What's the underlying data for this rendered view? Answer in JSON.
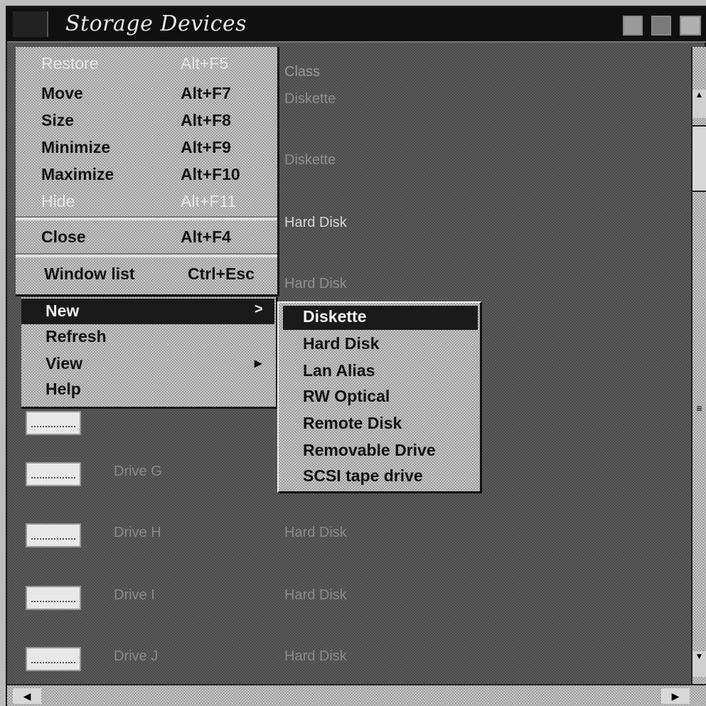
{
  "window": {
    "title": "Storage Devices"
  },
  "details": {
    "column_header": "Class",
    "class_values": [
      "Diskette",
      "Diskette",
      "Hard Disk",
      "Hard Disk"
    ]
  },
  "drives": [
    {
      "name": "Drive G",
      "class": ""
    },
    {
      "name": "Drive H",
      "class": "Hard Disk"
    },
    {
      "name": "Drive I",
      "class": "Hard Disk"
    },
    {
      "name": "Drive J",
      "class": "Hard Disk"
    }
  ],
  "system_menu": {
    "items": [
      {
        "label": "Restore",
        "accel": "Alt+F5",
        "enabled": false
      },
      {
        "label": "Move",
        "accel": "Alt+F7",
        "enabled": true
      },
      {
        "label": "Size",
        "accel": "Alt+F8",
        "enabled": true
      },
      {
        "label": "Minimize",
        "accel": "Alt+F9",
        "enabled": true
      },
      {
        "label": "Maximize",
        "accel": "Alt+F10",
        "enabled": true
      },
      {
        "label": "Hide",
        "accel": "Alt+F11",
        "enabled": false
      },
      {
        "label": "Close",
        "accel": "Alt+F4",
        "enabled": true
      },
      {
        "label": "Window list",
        "accel": "Ctrl+Esc",
        "enabled": true
      }
    ]
  },
  "context_menu": {
    "items": [
      {
        "label": "New",
        "submenu": true,
        "arrow": ">"
      },
      {
        "label": "Refresh",
        "submenu": false
      },
      {
        "label": "View",
        "submenu": true,
        "arrow": "▸"
      },
      {
        "label": "Help",
        "submenu": false
      }
    ]
  },
  "new_submenu": {
    "items": [
      "Diskette",
      "Hard Disk",
      "Lan Alias",
      "RW Optical",
      "Remote Disk",
      "Removable Drive",
      "SCSI tape drive"
    ]
  },
  "scrollbars": {
    "up": "▲",
    "down": "▼",
    "left": "◀",
    "right": "▶",
    "grip": "≡"
  },
  "icons": {
    "drive": "hard-drive-icon",
    "system_menu": "system-menu-icon"
  }
}
